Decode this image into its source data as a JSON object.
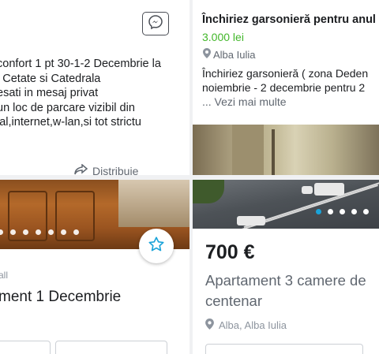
{
  "card1": {
    "description_lines": [
      "confort 1 pt 30-1-2 Decembrie la",
      "l Cetate si Catedrala",
      "esati in mesaj privat",
      "un loc de parcare vizibil din",
      "ial,internet,w-lan,si tot strictu"
    ],
    "share_label": "Distribuie",
    "icons": {
      "message": "messenger-icon",
      "share": "share-icon"
    }
  },
  "card2": {
    "title": "Închiriez garsonieră pentru anul c",
    "price": "3.000 lei",
    "location": "Alba Iulia",
    "description_lines": [
      "Închiriez garsonieră  ( zona Deden",
      "noiembrie - 2 decembrie pentru 2"
    ],
    "more_label": "... Vezi mai multe",
    "price_color": "#42b72a"
  },
  "card3": {
    "category": "all",
    "title": "ment 1 Decembrie",
    "photo_dots": 7,
    "chips": [
      "",
      ""
    ],
    "icons": {
      "save": "star-icon"
    }
  },
  "card4": {
    "price": "700 €",
    "title_lines": [
      "Apartament 3 camere de",
      "centenar"
    ],
    "location": "Alba, Alba Iulia",
    "photo_dots": 5,
    "active_dot": 0,
    "accent_color": "#1aa3d9"
  }
}
